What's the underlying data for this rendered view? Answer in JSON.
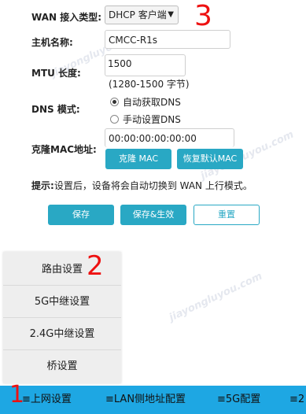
{
  "form": {
    "wan_type_label": "WAN 接入类型:",
    "wan_type_value": "DHCP 客户端",
    "hostname_label": "主机名称:",
    "hostname_value": "CMCC-R1s",
    "mtu_label": "MTU 长度:",
    "mtu_value": "1500",
    "mtu_hint": "(1280-1500 字节)",
    "dns_label": "DNS 模式:",
    "dns_auto": "自动获取DNS",
    "dns_manual": "手动设置DNS",
    "mac_label": "克隆MAC地址:",
    "mac_value": "00:00:00:00:00:00",
    "clone_mac": "克隆 MAC",
    "restore_mac": "恢复默认MAC",
    "note_label": "提示:",
    "note_text": "设置后，设备将会自动切换到 WAN 上行模式。",
    "save": "保存",
    "save_apply": "保存&生效",
    "reset": "重置"
  },
  "menu": {
    "items": [
      "路由设置",
      "5G中继设置",
      "2.4G中继设置",
      "桥设置"
    ]
  },
  "tabbar": {
    "tabs": [
      "≡上网设置",
      "≡LAN侧地址配置",
      "≡5G配置",
      "≡2"
    ]
  },
  "annotations": [
    "1",
    "2",
    "3"
  ],
  "watermark": "jiayongluyou.com",
  "colors": {
    "accent": "#29a8c4",
    "tabbar": "#1ea7e3",
    "annotation": "#ee1111"
  }
}
